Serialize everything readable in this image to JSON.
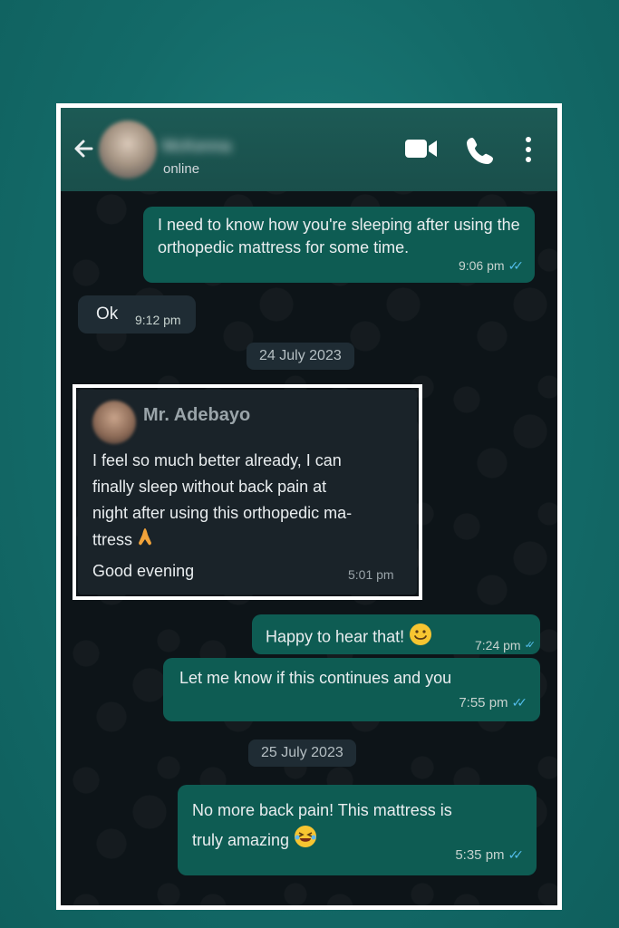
{
  "header": {
    "contact_name": "McKenna",
    "status": "online"
  },
  "messages": [
    {
      "text": "I need to know how you're sleeping after using the orthopedic mattress for some time.",
      "time": "9:06 pm",
      "direction": "out"
    },
    {
      "text": "Ok",
      "time": "9:12 pm",
      "direction": "in"
    }
  ],
  "date_chips": [
    "24 July 2023",
    "25 July 2023"
  ],
  "quoted": {
    "name": "Mr. Adebayo",
    "text": "I feel so much better already, I can finally sleep without back pain at night after using this orthopedic ma-ttress 🙏",
    "line1": "I feel so much better already, I can",
    "line2": "finally sleep without back pain at",
    "line3": "night after using this orthopedic ma-",
    "line4": "ttress",
    "greeting": "Good evening",
    "time": "5:01 pm"
  },
  "later_messages": [
    {
      "text": "Happy to hear that!",
      "time": "7:24 pm",
      "direction": "out"
    },
    {
      "text": "Let me know if this continues and you",
      "time": "7:55 pm",
      "direction": "out"
    },
    {
      "text": "No more back pain! This mattress is truly amazing",
      "line1": "No more back pain! This mattress is",
      "line2": "truly amazing",
      "time": "5:35 pm",
      "direction": "out"
    }
  ],
  "colors": {
    "accent": "#0e5c53",
    "read_ticks": "#53bdeb",
    "background": "#136a68"
  },
  "icons": [
    "back-arrow-icon",
    "video-call-icon",
    "phone-call-icon",
    "more-options-icon",
    "read-ticks-icon",
    "pray-emoji-icon",
    "smile-emoji-icon",
    "laughing-emoji-icon"
  ]
}
